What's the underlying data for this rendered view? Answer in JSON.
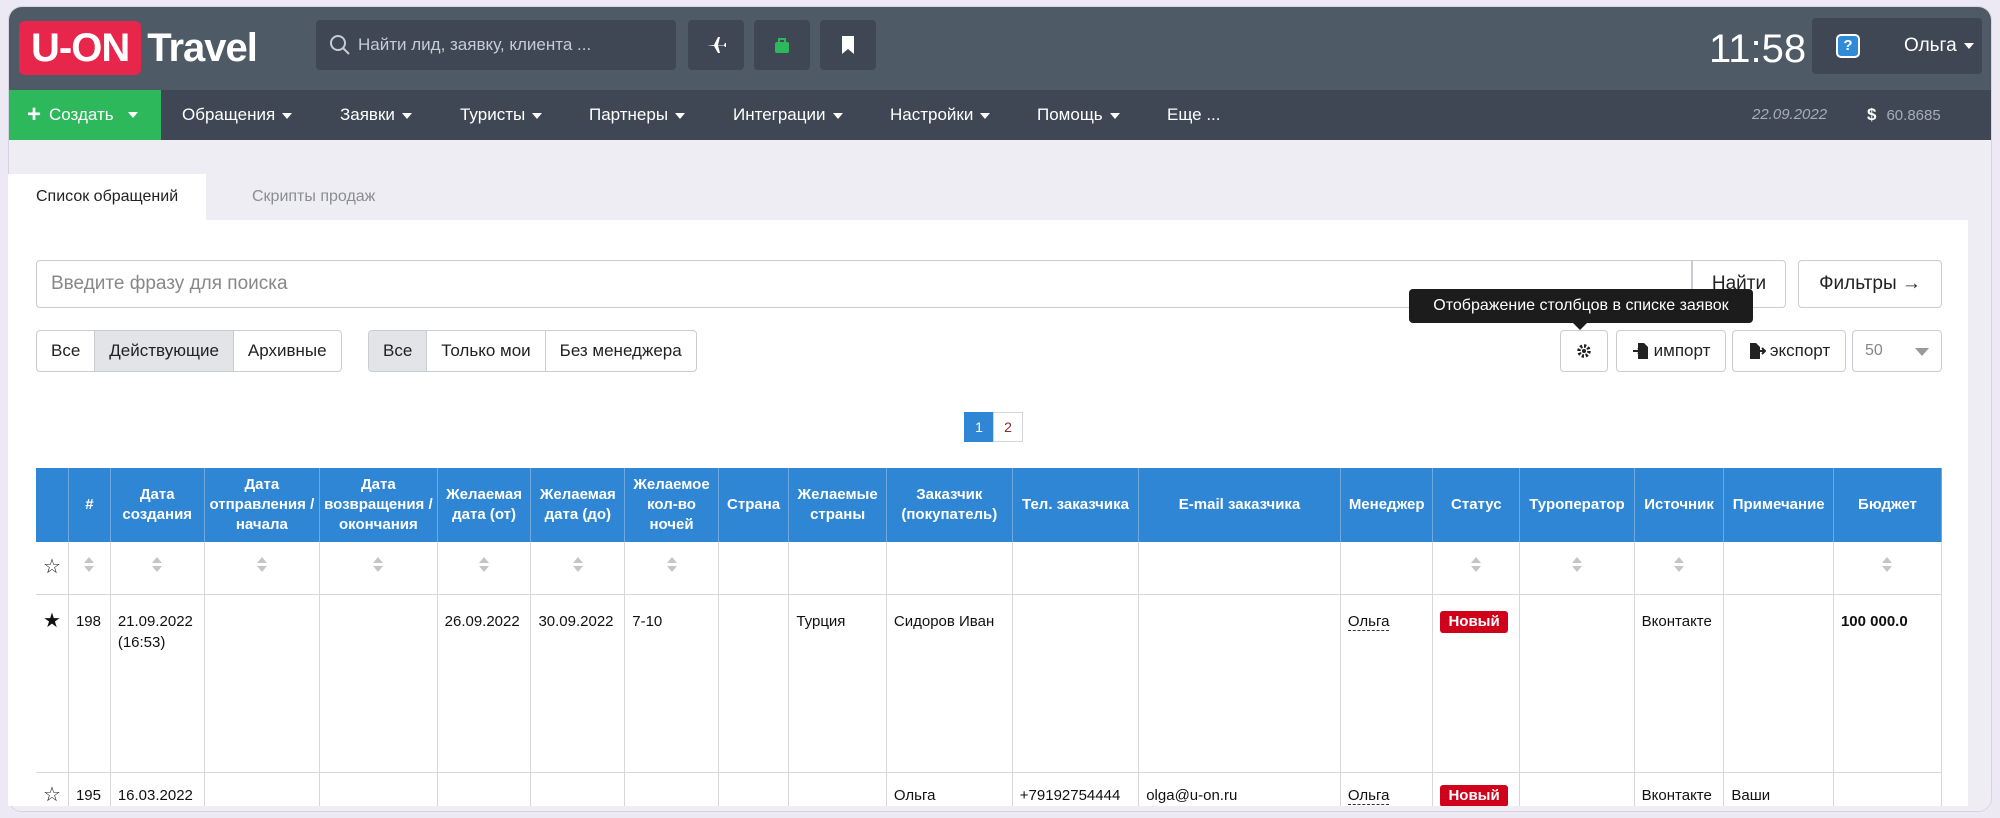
{
  "app": {
    "logo_left": "U-ON",
    "logo_right": "Travel",
    "brand_color": "#e8264b"
  },
  "search": {
    "placeholder": "Найти лид, заявку, клиента ..."
  },
  "clock": "11:58",
  "user": {
    "name": "Ольга",
    "help_glyph": "?"
  },
  "nav": {
    "create": "Создать",
    "items": [
      "Обращения",
      "Заявки",
      "Туристы",
      "Партнеры",
      "Интеграции",
      "Настройки",
      "Помощь",
      "Еще ..."
    ],
    "date": "22.09.2022",
    "currency_symbol": "$",
    "rate": "60.8685"
  },
  "tabs": [
    "Список обращений",
    "Скрипты продаж"
  ],
  "filterbar": {
    "search_placeholder": "Введите фразу для поиска",
    "find": "Найти",
    "filters": "Фильтры →"
  },
  "segments": {
    "status": [
      "Все",
      "Действующие",
      "Архивные"
    ],
    "owner": [
      "Все",
      "Только мои",
      "Без менеджера"
    ]
  },
  "tooltip": "Отображение столбцов в списке заявок",
  "tools": {
    "import": "импорт",
    "export": "экспорт",
    "per_page": "50"
  },
  "pagination": {
    "pages": [
      "1",
      "2"
    ],
    "current": "1"
  },
  "table": {
    "headers": [
      "",
      "#",
      "Дата создания",
      "Дата отправления / начала",
      "Дата возвращения / окончания",
      "Желаемая дата (от)",
      "Желаемая дата (до)",
      "Желаемое кол-во ночей",
      "Страна",
      "Желаемые страны",
      "Заказчик (покупатель)",
      "Тел. заказчика",
      "E-mail заказчика",
      "Менеджер",
      "Статус",
      "Туроператор",
      "Источник",
      "Примечание",
      "Бюджет"
    ],
    "rows": [
      {
        "starred": true,
        "id": "198",
        "created": "21.09.2022",
        "created_time": "(16:53)",
        "dep": "",
        "ret": "",
        "from": "26.09.2022",
        "to": "30.09.2022",
        "nights": "7-10",
        "country": "",
        "countries": "Турция",
        "customer": "Сидоров Иван",
        "phone": "",
        "email": "",
        "manager": "Ольга",
        "status": "Новый",
        "operator": "",
        "source": "Вконтакте",
        "note": "",
        "budget": "100 000.0"
      },
      {
        "starred": false,
        "id": "195",
        "created": "16.03.2022",
        "created_time": "",
        "dep": "",
        "ret": "",
        "from": "",
        "to": "",
        "nights": "",
        "country": "",
        "countries": "",
        "customer": "Ольга",
        "phone": "+79192754444",
        "email": "olga@u-on.ru",
        "manager": "Ольга",
        "status": "Новый",
        "operator": "",
        "source": "Вконтакте",
        "note": "Ваши",
        "budget": ""
      }
    ]
  },
  "colors": {
    "accent": "#2f86d4",
    "create_green": "#2eb85c",
    "status_new": "#d0021b"
  }
}
